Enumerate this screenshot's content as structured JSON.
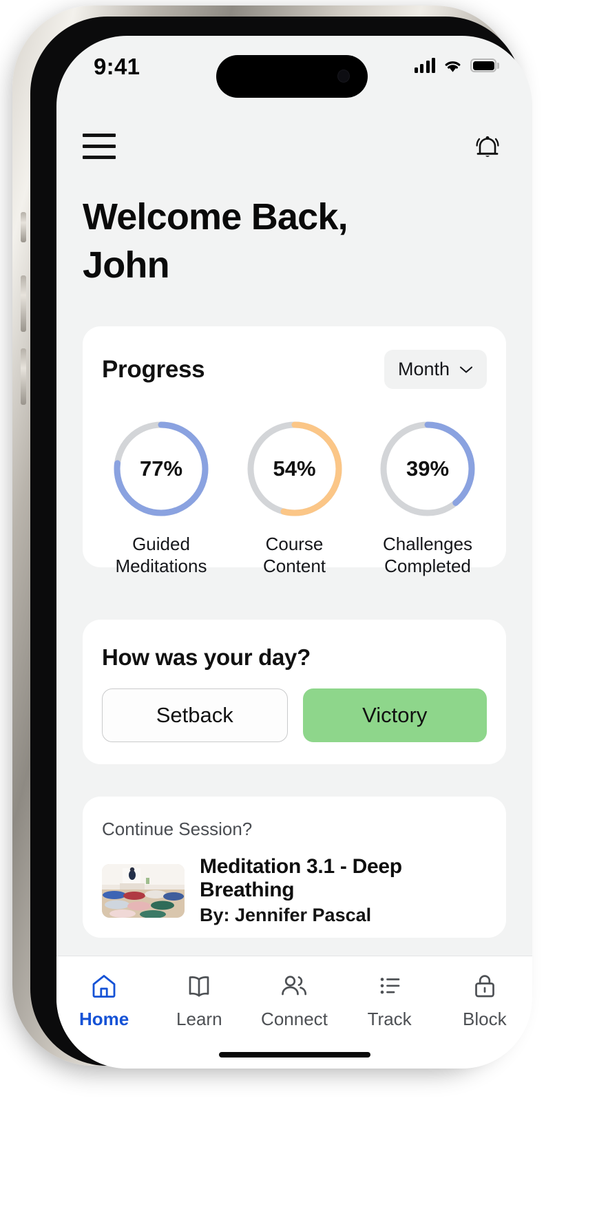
{
  "status_bar": {
    "time": "9:41",
    "cellular_icon": "signal-bars-icon",
    "wifi_icon": "wifi-icon",
    "battery_icon": "battery-full-icon"
  },
  "header": {
    "menu_icon": "hamburger-menu-icon",
    "notification_icon": "bell-icon"
  },
  "page": {
    "title": "Welcome Back, John",
    "title_line1": "Welcome Back,",
    "title_line2": "John"
  },
  "progress_card": {
    "title": "Progress",
    "period_value": "Month",
    "period_chevron_icon": "chevron-down-icon",
    "metrics": [
      {
        "value": "77%",
        "percent": 77,
        "label": "Guided Meditations",
        "label_line1": "Guided",
        "label_line2": "Meditations",
        "color": "#8aa2e0",
        "track": "#d3d5d8"
      },
      {
        "value": "54%",
        "percent": 54,
        "label": "Course Content",
        "label_line1": "Course",
        "label_line2": "Content",
        "color": "#fbc687",
        "track": "#d3d5d8"
      },
      {
        "value": "39%",
        "percent": 39,
        "label": "Challenges Completed",
        "label_line1": "Challenges",
        "label_line2": "Completed",
        "color": "#8aa2e0",
        "track": "#d3d5d8"
      }
    ]
  },
  "mood_card": {
    "title": "How was your day?",
    "setback_label": "Setback",
    "victory_label": "Victory",
    "victory_color": "#8ed68b"
  },
  "session_card": {
    "prompt": "Continue Session?",
    "thumbnail_name": "meditation-class-thumbnail",
    "title": "Meditation 3.1 - Deep Breathing",
    "author": "By: Jennifer Pascal"
  },
  "tabbar": {
    "active": "Home",
    "active_color": "#1552d6",
    "items": [
      {
        "label": "Home",
        "icon": "home-icon",
        "active": true
      },
      {
        "label": "Learn",
        "icon": "book-open-icon",
        "active": false
      },
      {
        "label": "Connect",
        "icon": "people-icon",
        "active": false
      },
      {
        "label": "Track",
        "icon": "list-checklist-icon",
        "active": false
      },
      {
        "label": "Block",
        "icon": "lock-icon",
        "active": false
      }
    ]
  }
}
